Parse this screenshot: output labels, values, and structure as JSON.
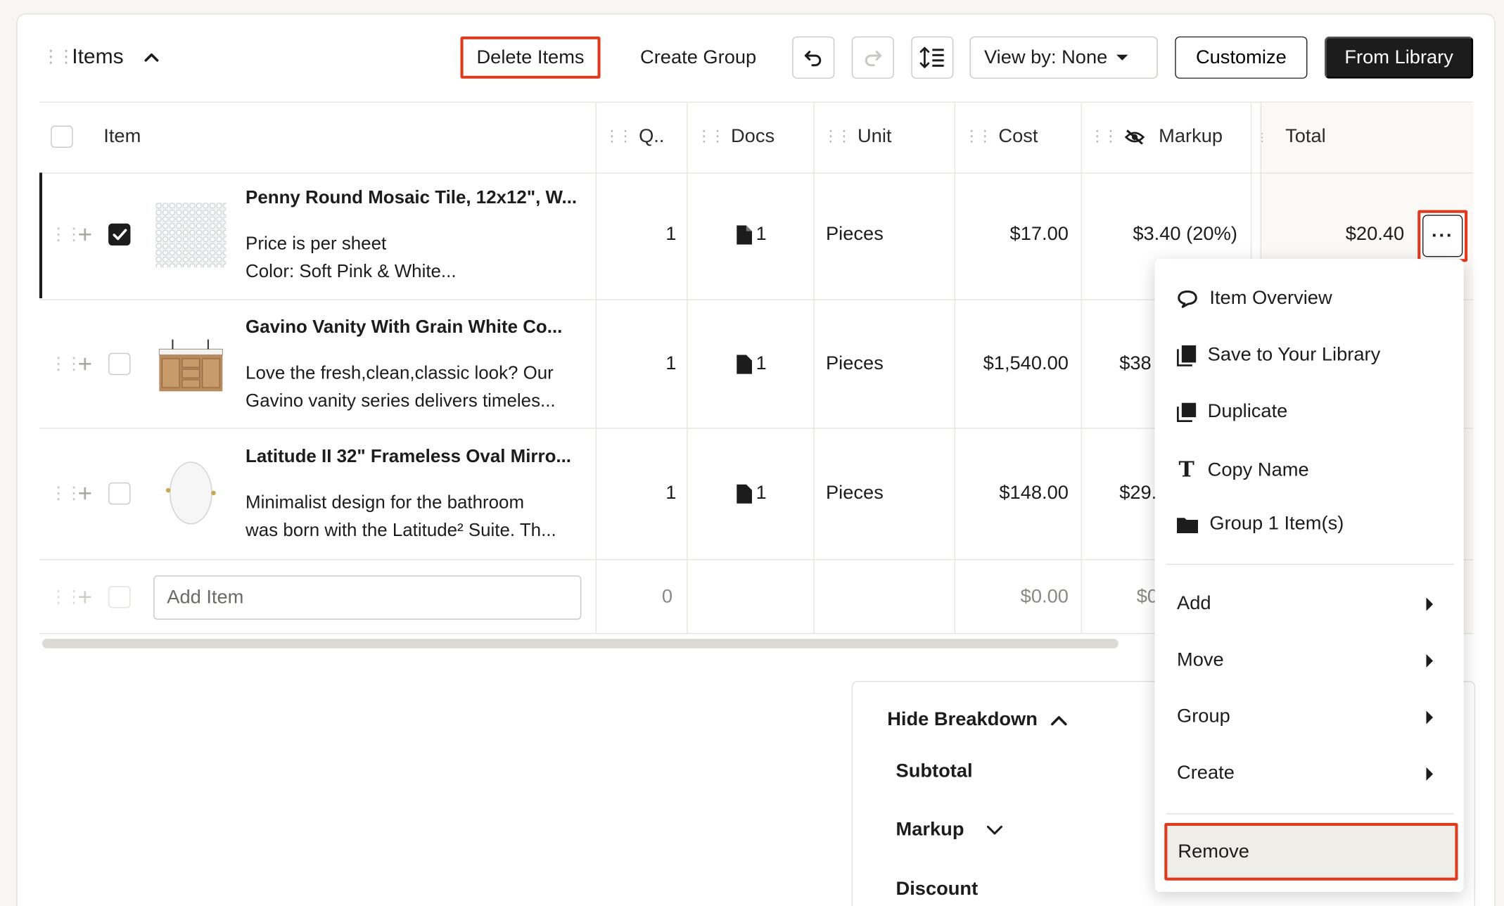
{
  "toolbar": {
    "title": "Items",
    "delete_label": "Delete Items",
    "create_group_label": "Create Group",
    "view_by_label": "View by: None",
    "customize_label": "Customize",
    "from_library_label": "From Library"
  },
  "columns": {
    "item": "Item",
    "qty": "Q..",
    "docs": "Docs",
    "unit": "Unit",
    "cost": "Cost",
    "markup": "Markup",
    "total": "Total"
  },
  "rows": [
    {
      "name": "Penny Round Mosaic Tile, 12x12\", W...",
      "desc1": "Price is per sheet",
      "desc2": "Color: Soft Pink & White...",
      "qty": "1",
      "docs": "1",
      "unit": "Pieces",
      "cost": "$17.00",
      "markup": "$3.40 (20%)",
      "total": "$20.40",
      "checked": true
    },
    {
      "name": "Gavino Vanity With Grain White Co...",
      "desc1": "Love the fresh,clean,classic look? Our",
      "desc2": "Gavino vanity series delivers timeles...",
      "qty": "1",
      "docs": "1",
      "unit": "Pieces",
      "cost": "$1,540.00",
      "markup": "$38",
      "checked": false
    },
    {
      "name": "Latitude II 32\" Frameless Oval Mirro...",
      "desc1": "Minimalist design for the bathroom",
      "desc2": "was born with the Latitude² Suite. Th...",
      "qty": "1",
      "docs": "1",
      "unit": "Pieces",
      "cost": "$148.00",
      "markup": "$29.",
      "checked": false
    }
  ],
  "add_row": {
    "placeholder": "Add Item",
    "qty": "0",
    "cost": "$0.00",
    "markup": "$0"
  },
  "breakdown": {
    "toggle_label": "Hide Breakdown",
    "subtotal": "Subtotal",
    "markup": "Markup",
    "discount": "Discount"
  },
  "context_menu": {
    "items": [
      "Item Overview",
      "Save to Your Library",
      "Duplicate",
      "Copy Name",
      "Group 1 Item(s)"
    ],
    "submenus": [
      "Add",
      "Move",
      "Group",
      "Create"
    ],
    "remove": "Remove"
  },
  "colors": {
    "accent_highlight": "#e03a1e",
    "primary_dark": "#1c1c1c"
  }
}
